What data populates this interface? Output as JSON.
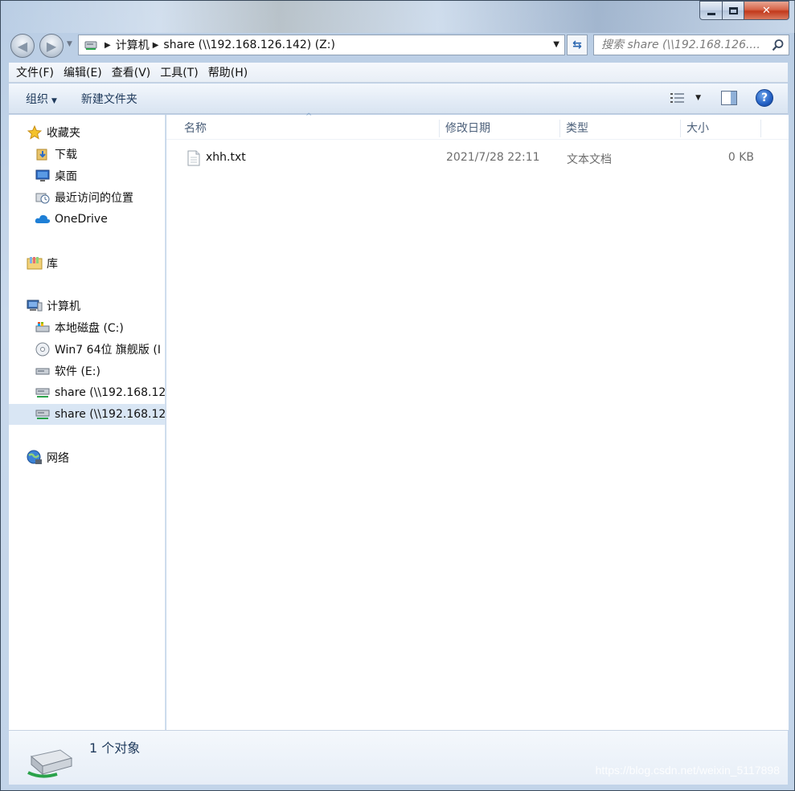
{
  "address": {
    "crumbs": [
      "计算机",
      "share (\\\\192.168.126.142) (Z:)"
    ]
  },
  "search": {
    "placeholder": "搜索 share (\\\\192.168.126...."
  },
  "menu": {
    "items": [
      "文件(F)",
      "编辑(E)",
      "查看(V)",
      "工具(T)",
      "帮助(H)"
    ]
  },
  "toolbar": {
    "organize": "组织",
    "new_folder": "新建文件夹",
    "help_glyph": "?"
  },
  "nav_pane": {
    "favorites": "收藏夹",
    "downloads": "下载",
    "desktop": "桌面",
    "recent": "最近访问的位置",
    "onedrive": "OneDrive",
    "libraries": "库",
    "computer": "计算机",
    "drive_c": "本地磁盘 (C:)",
    "drive_dvd": "Win7 64位 旗舰版 (I",
    "drive_e": "软件 (E:)",
    "share_1": "share (\\\\192.168.12",
    "share_2": "share (\\\\192.168.12",
    "network": "网络"
  },
  "columns": {
    "name": "名称",
    "date": "修改日期",
    "type": "类型",
    "size": "大小"
  },
  "files": [
    {
      "name": "xhh.txt",
      "modified": "2021/7/28 22:11",
      "type": "文本文档",
      "size": "0 KB"
    }
  ],
  "details": {
    "count": "1 个对象"
  },
  "watermark": "https://blog.csdn.net/weixin_5117898",
  "icons": {
    "back": "back-arrow-icon",
    "forward": "forward-arrow-icon",
    "refresh": "refresh-icon",
    "search": "search-icon",
    "help": "help-icon"
  },
  "colors": {
    "selection": "#d9e6f4",
    "command_text": "#1e395b",
    "header_text": "#4c607a"
  }
}
